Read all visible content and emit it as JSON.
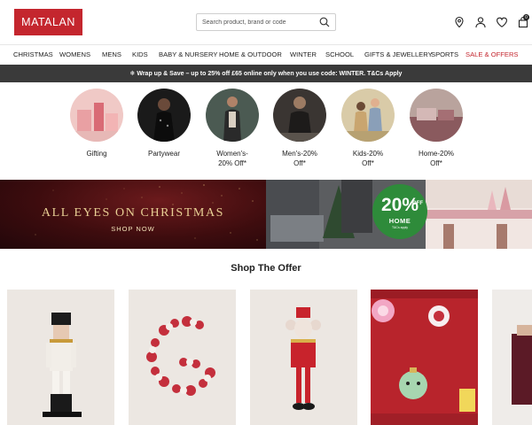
{
  "brand": {
    "logo_text": "MATALAN",
    "accent": "#c4262e"
  },
  "search": {
    "placeholder": "Search product, brand or code",
    "icon": "search-icon"
  },
  "header_icons": [
    "location-pin-icon",
    "user-icon",
    "heart-icon",
    "bag-icon"
  ],
  "bag_count": "0",
  "nav": {
    "items": [
      "CHRISTMAS",
      "WOMENS",
      "MENS",
      "KIDS",
      "BABY & NURSERY",
      "HOME & OUTDOOR",
      "WINTER",
      "SCHOOL",
      "GIFTS & JEWELLERY",
      "SPORTS",
      "SALE & OFFERS"
    ]
  },
  "promo": {
    "text": "❄ Wrap up & Save – up to 25% off £65 online only when you use code: WINTER. T&Cs Apply"
  },
  "categories": [
    {
      "line1": "Gifting",
      "line2": ""
    },
    {
      "line1": "Partywear",
      "line2": ""
    },
    {
      "line1": "Women's-",
      "line2": "20% Off*"
    },
    {
      "line1": "Men's-20%",
      "line2": "Off*"
    },
    {
      "line1": "Kids-20%",
      "line2": "Off*"
    },
    {
      "line1": "Home-20%",
      "line2": "Off*"
    }
  ],
  "banner": {
    "title": "ALL EYES ON CHRISTMAS",
    "cta": "SHOP NOW",
    "badge_pct": "20%",
    "badge_off": "OFF",
    "badge_label": "HOME",
    "badge_tcs": "T&Cs apply"
  },
  "offers": {
    "title": "Shop The Offer"
  }
}
